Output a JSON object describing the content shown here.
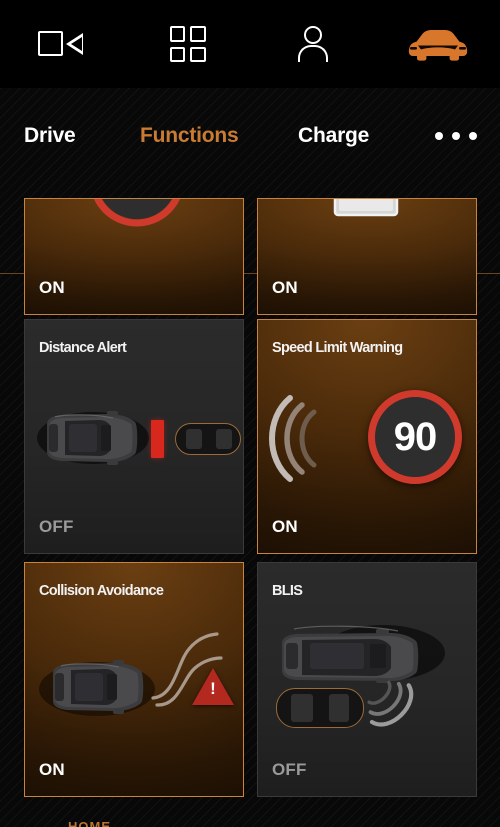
{
  "topbar": {
    "icons": [
      {
        "name": "camera-icon",
        "label": "Camera"
      },
      {
        "name": "grid-icon",
        "label": "Apps"
      },
      {
        "name": "user-icon",
        "label": "Profile"
      },
      {
        "name": "car-icon",
        "label": "Vehicle"
      }
    ]
  },
  "tabs": {
    "items": [
      {
        "label": "Drive",
        "active": false
      },
      {
        "label": "Functions",
        "active": true
      },
      {
        "label": "Charge",
        "active": false
      }
    ],
    "more_label": "More options",
    "active_color": "#c97b32"
  },
  "cards": [
    {
      "id": "top-left",
      "title": "",
      "state": "ON",
      "icon": "speed-sign-partial-icon",
      "clipped": true
    },
    {
      "id": "top-right",
      "title": "",
      "state": "ON",
      "icon": "road-sign-partial-icon",
      "clipped": true
    },
    {
      "id": "distance-alert",
      "title": "Distance Alert",
      "state": "OFF",
      "icon": "car-distance-icon"
    },
    {
      "id": "speed-limit-warning",
      "title": "Speed Limit Warning",
      "state": "ON",
      "icon": "speed-sign-icon",
      "speed_value": "90"
    },
    {
      "id": "collision-avoidance",
      "title": "Collision Avoidance",
      "state": "ON",
      "icon": "car-swerve-warning-icon"
    },
    {
      "id": "blis",
      "title": "BLIS",
      "state": "OFF",
      "icon": "blind-spot-icon"
    }
  ],
  "footer": {
    "home_label": "HOME"
  },
  "colors": {
    "accent": "#c97b32",
    "card_on_border": "#c8833f",
    "card_off_border": "#3a3a3a",
    "warning_red": "#b3281f",
    "sign_red": "#d03a30",
    "state_on_text": "#ffffff",
    "state_off_text": "#9a9a9a",
    "background": "#080808"
  }
}
